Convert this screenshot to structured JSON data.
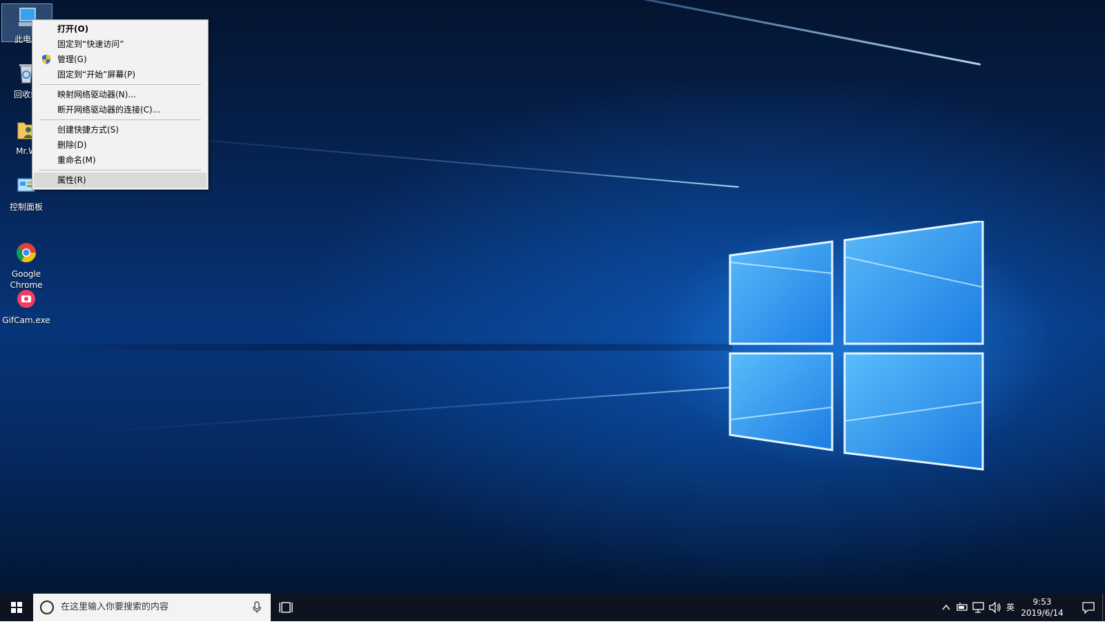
{
  "desktop": {
    "icons": [
      {
        "label": "此电脑",
        "icon": "computer-icon"
      },
      {
        "label": "回收站",
        "icon": "recycle-bin-icon"
      },
      {
        "label": "Mr.W",
        "icon": "user-folder-icon"
      },
      {
        "label": "控制面板",
        "icon": "control-panel-icon"
      },
      {
        "label": "Google\nChrome",
        "icon": "chrome-icon"
      },
      {
        "label": "GifCam.exe",
        "icon": "gifcam-icon"
      }
    ]
  },
  "context_menu": {
    "items": [
      {
        "label": "打开(O)"
      },
      {
        "label": "固定到“快速访问”"
      },
      {
        "label": "管理(G)",
        "icon": "shield-icon"
      },
      {
        "label": "固定到“开始”屏幕(P)"
      },
      {
        "label": "映射网络驱动器(N)..."
      },
      {
        "label": "断开网络驱动器的连接(C)..."
      },
      {
        "label": "创建快捷方式(S)"
      },
      {
        "label": "删除(D)"
      },
      {
        "label": "重命名(M)"
      },
      {
        "label": "属性(R)"
      }
    ]
  },
  "taskbar": {
    "search_placeholder": "在这里输入你要搜索的内容",
    "tray": {
      "input_method": "英"
    },
    "clock": {
      "time": "9:53",
      "date": "2019/6/14"
    }
  }
}
